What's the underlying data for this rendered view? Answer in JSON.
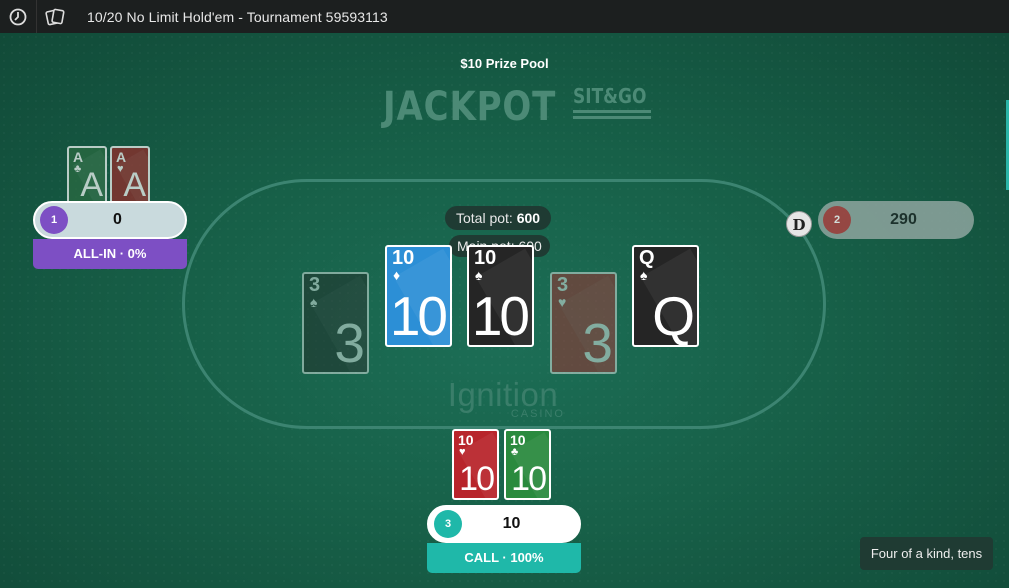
{
  "topbar": {
    "title": "10/20 No Limit Hold'em - Tournament 59593113",
    "icons": [
      "timer-icon",
      "cards-icon"
    ]
  },
  "table": {
    "prize_pool": "$10 Prize Pool",
    "logo_big": "JACKPOT",
    "logo_small": "SIT&GO",
    "brand_name": "Ignition",
    "brand_sub": "CASINO",
    "total_pot_label": "Total pot:",
    "total_pot_value": "600",
    "main_pot_label": "Main pot:",
    "main_pot_value": "600"
  },
  "board": [
    {
      "rank": "3",
      "suit": "♠",
      "color": "black",
      "dimmed": true
    },
    {
      "rank": "10",
      "suit": "♦",
      "color": "blue",
      "dimmed": false
    },
    {
      "rank": "10",
      "suit": "♠",
      "color": "black",
      "dimmed": false
    },
    {
      "rank": "3",
      "suit": "♥",
      "color": "red",
      "dimmed": true
    },
    {
      "rank": "Q",
      "suit": "♠",
      "color": "black",
      "dimmed": false
    }
  ],
  "players": [
    {
      "seat": "1",
      "stack": "0",
      "action": "ALL-IN · 0%",
      "seat_color": "#7d4fc4",
      "action_color": "#7d4fc4",
      "cards": [
        {
          "rank": "A",
          "suit": "♣",
          "color": "green"
        },
        {
          "rank": "A",
          "suit": "♥",
          "color": "red"
        }
      ]
    },
    {
      "seat": "2",
      "stack": "290",
      "seat_color": "#b03a3a",
      "folded": true
    },
    {
      "seat": "3",
      "stack": "10",
      "action": "CALL · 100%",
      "seat_color": "#1fb8a9",
      "action_color": "#1fb8a9",
      "cards": [
        {
          "rank": "10",
          "suit": "♥",
          "color": "red"
        },
        {
          "rank": "10",
          "suit": "♣",
          "color": "green"
        }
      ]
    }
  ],
  "dealer_button": "D",
  "hand_strength": "Four of a kind, tens"
}
